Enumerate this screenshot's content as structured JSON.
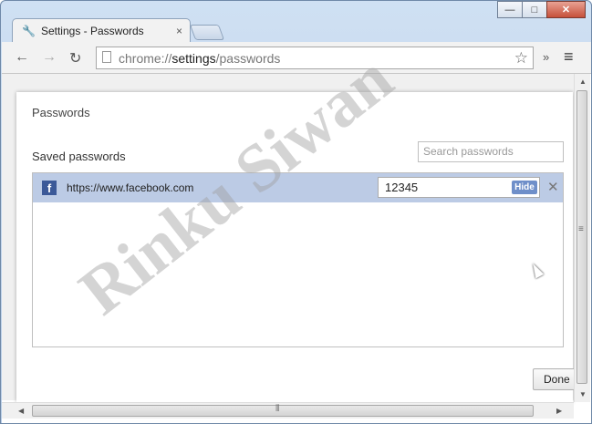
{
  "window": {
    "minimize": "—",
    "maximize": "□",
    "close": "✕"
  },
  "tab": {
    "title": "Settings - Passwords",
    "close": "×"
  },
  "toolbar": {
    "back": "←",
    "forward": "→",
    "reload": "↻",
    "overflow": "»",
    "menu": "≡",
    "star": "☆"
  },
  "address": {
    "scheme": "chrome://",
    "host": "settings",
    "path": "/passwords"
  },
  "dialog": {
    "title": "Passwords",
    "saved_label": "Saved passwords",
    "search_placeholder": "Search passwords",
    "rows": [
      {
        "site": "https://www.facebook.com",
        "password": "12345",
        "hide_label": "Hide",
        "remove": "✕"
      }
    ],
    "done_label": "Done"
  },
  "watermark": "Rinku Siwan"
}
